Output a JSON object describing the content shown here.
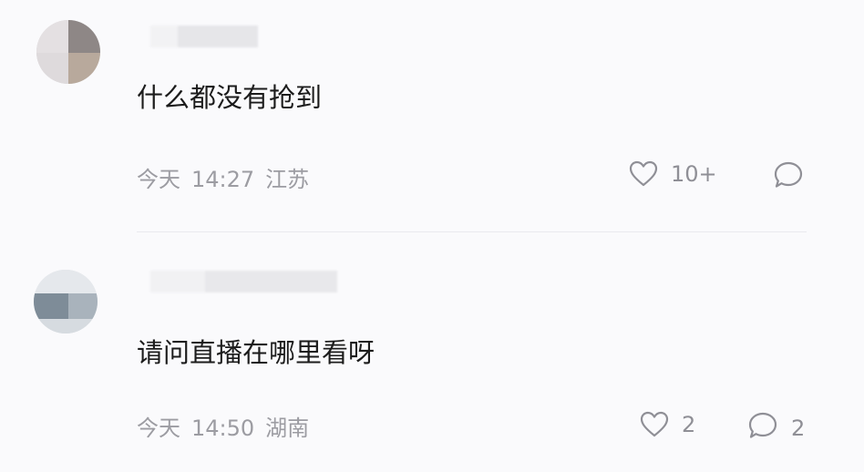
{
  "comments": [
    {
      "content": "什么都没有抢到",
      "date": "今天",
      "time": "14:27",
      "location": "江苏",
      "likes": "10+",
      "replies": ""
    },
    {
      "content": "请问直播在哪里看呀",
      "date": "今天",
      "time": "14:50",
      "location": "湖南",
      "likes": "2",
      "replies": "2"
    }
  ],
  "icons": {
    "like": "heart-outline-icon",
    "reply": "speech-bubble-outline-icon"
  },
  "colors": {
    "background": "#fafafc",
    "content_text": "#1c1c1c",
    "meta_text": "#9c9ca2",
    "icon": "#8f8f96",
    "divider": "#e9e9ee"
  }
}
